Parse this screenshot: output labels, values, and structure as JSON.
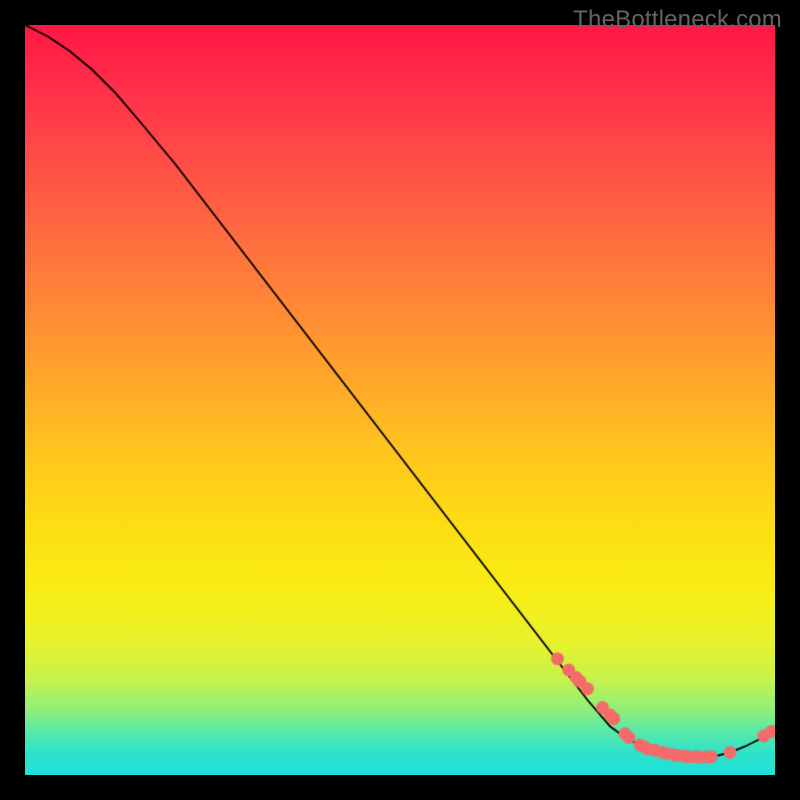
{
  "watermark": "TheBottleneck.com",
  "chart_data": {
    "type": "line",
    "title": "",
    "xlabel": "",
    "ylabel": "",
    "xlim": [
      0,
      100
    ],
    "ylim": [
      0,
      100
    ],
    "grid": false,
    "series": [
      {
        "name": "curve",
        "style": "line",
        "color": "#000000",
        "x": [
          0,
          3,
          6,
          9,
          12,
          15,
          20,
          25,
          30,
          35,
          40,
          45,
          50,
          55,
          60,
          65,
          70,
          75,
          78,
          80,
          82,
          84,
          86,
          88,
          90,
          92,
          94,
          96,
          98,
          100
        ],
        "y": [
          100,
          98.5,
          96.5,
          94,
          91,
          87.5,
          81.5,
          75,
          68.5,
          62,
          55.5,
          49,
          42.5,
          36,
          29.5,
          23,
          16.5,
          10,
          6.5,
          5,
          4,
          3.3,
          2.8,
          2.5,
          2.4,
          2.5,
          3.0,
          3.8,
          4.8,
          6.0
        ]
      },
      {
        "name": "points",
        "style": "scatter",
        "color": "#f56b6b",
        "x": [
          71,
          72.5,
          73.5,
          74,
          75,
          77,
          78,
          78.5,
          80,
          80.5,
          82,
          82.5,
          83,
          84,
          85,
          85.5,
          86.5,
          87,
          88,
          88.5,
          89.5,
          90,
          91,
          91.5,
          94,
          98.5,
          99.5
        ],
        "y": [
          15.5,
          14,
          13,
          12.5,
          11.5,
          9,
          8,
          7.5,
          5.5,
          5,
          4,
          3.8,
          3.5,
          3.3,
          3.0,
          2.9,
          2.7,
          2.6,
          2.5,
          2.45,
          2.42,
          2.4,
          2.42,
          2.45,
          3.0,
          5.2,
          5.8
        ]
      }
    ]
  }
}
